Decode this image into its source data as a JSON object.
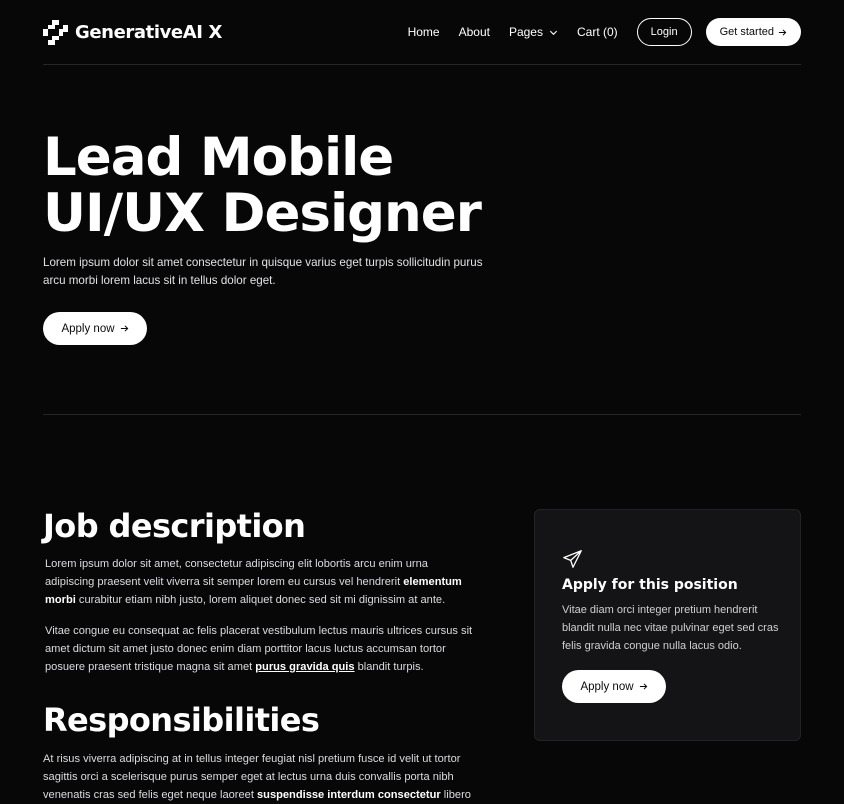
{
  "brand": {
    "name": "GenerativeAI X"
  },
  "nav": {
    "links": [
      "Home",
      "About",
      "Pages",
      "Cart (0)"
    ],
    "login": "Login",
    "get_started": "Get started"
  },
  "hero": {
    "title_line1": "Lead Mobile",
    "title_line2": "UI/UX Designer",
    "text": "Lorem ipsum dolor sit amet consectetur in quisque varius eget turpis sollicitudin purus arcu morbi lorem lacus sit in tellus dolor eget.",
    "apply": "Apply now"
  },
  "job": {
    "heading": "Job description",
    "p1_a": "Lorem ipsum dolor sit amet, consectetur adipiscing elit lobortis arcu enim urna adipiscing praesent velit viverra sit semper lorem eu cursus vel hendrerit ",
    "p1_bold": "elementum morbi",
    "p1_b": " curabitur etiam nibh justo, lorem aliquet donec sed sit mi dignissim at ante.",
    "p2_a": "Vitae congue eu consequat ac felis placerat vestibulum lectus mauris ultrices cursus sit amet dictum sit amet justo donec enim diam porttitor lacus luctus accumsan tortor posuere praesent tristique magna sit amet ",
    "p2_link": "purus gravida quis",
    "p2_b": " blandit turpis."
  },
  "responsibilities": {
    "heading": "Responsibilities",
    "p1_a": "At risus viverra adipiscing at in tellus integer feugiat nisl pretium fusce id velit ut tortor sagittis orci a scelerisque purus semper eget at lectus urna duis convallis porta nibh venenatis cras sed felis eget neque laoreet ",
    "p1_bold": "suspendisse interdum consectetur",
    "p1_b": " libero"
  },
  "card": {
    "title": "Apply for this position",
    "text": "Vitae diam orci integer pretium hendrerit blandit nulla nec vitae pulvinar eget sed cras felis gravida congue nulla lacus odio.",
    "apply": "Apply now"
  },
  "icons": [
    "logo-mark-icon",
    "chevron-down-icon",
    "arrow-right-icon",
    "paper-plane-icon"
  ]
}
